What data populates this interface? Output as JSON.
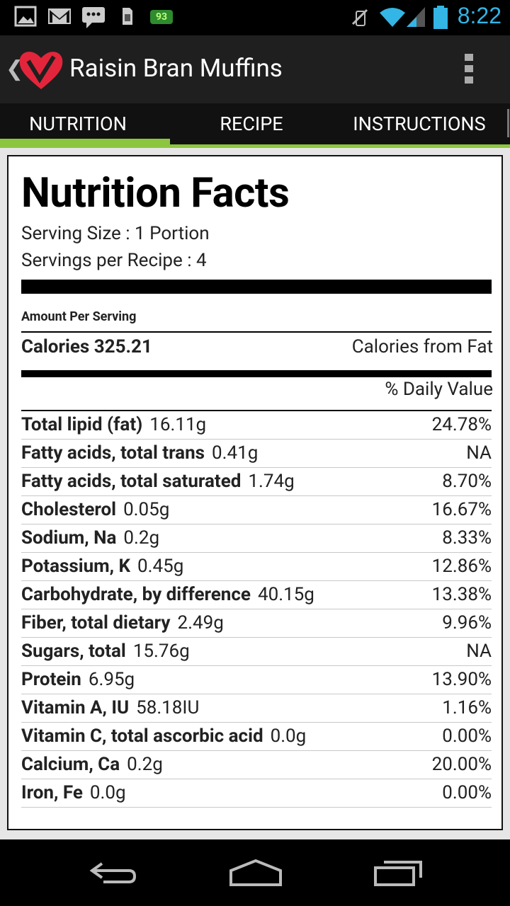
{
  "status_bar": {
    "time": "8:22",
    "battery_badge": "93",
    "icons": [
      "picture-icon",
      "gmail-icon",
      "chat-icon",
      "sim-icon",
      "battery-badge-icon",
      "mute-icon",
      "wifi-icon",
      "signal-icon",
      "battery-icon"
    ],
    "accent": "#33b5e5"
  },
  "action_bar": {
    "title": "Raisin Bran Muffins",
    "back_icon": "chevron-left-icon",
    "logo_icon": "heart-logo-icon",
    "overflow_icon": "overflow-menu-icon"
  },
  "tabs": [
    {
      "label": "NUTRITION",
      "selected": true
    },
    {
      "label": "RECIPE",
      "selected": false
    },
    {
      "label": "INSTRUCTIONS",
      "selected": false
    }
  ],
  "tab_accent": "#8cc63f",
  "nutrition": {
    "title": "Nutrition Facts",
    "serving_size": "Serving Size : 1 Portion",
    "servings_per_recipe": "Servings per Recipe : 4",
    "amount_per_serving": "Amount Per Serving",
    "calories": "Calories 325.21",
    "calories_from_fat": "Calories from Fat",
    "daily_value_header": "% Daily Value",
    "rows": [
      {
        "name": "Total lipid (fat)",
        "amount": "16.11g",
        "dv": "24.78%"
      },
      {
        "name": "Fatty acids, total trans",
        "amount": "0.41g",
        "dv": "NA"
      },
      {
        "name": "Fatty acids, total saturated",
        "amount": "1.74g",
        "dv": "8.70%"
      },
      {
        "name": "Cholesterol",
        "amount": "0.05g",
        "dv": "16.67%"
      },
      {
        "name": "Sodium, Na",
        "amount": "0.2g",
        "dv": "8.33%"
      },
      {
        "name": "Potassium, K",
        "amount": "0.45g",
        "dv": "12.86%"
      },
      {
        "name": "Carbohydrate, by difference",
        "amount": "40.15g",
        "dv": "13.38%"
      },
      {
        "name": "Fiber, total dietary",
        "amount": "2.49g",
        "dv": "9.96%"
      },
      {
        "name": "Sugars, total",
        "amount": "15.76g",
        "dv": "NA"
      },
      {
        "name": "Protein",
        "amount": "6.95g",
        "dv": "13.90%"
      },
      {
        "name": "Vitamin A, IU",
        "amount": "58.18IU",
        "dv": "1.16%"
      },
      {
        "name": "Vitamin C, total ascorbic acid",
        "amount": "0.0g",
        "dv": "0.00%"
      },
      {
        "name": "Calcium, Ca",
        "amount": "0.2g",
        "dv": "20.00%"
      },
      {
        "name": "Iron, Fe",
        "amount": "0.0g",
        "dv": "0.00%"
      }
    ]
  },
  "nav_bar": {
    "icons": [
      "back-icon",
      "home-icon",
      "recent-apps-icon"
    ]
  }
}
